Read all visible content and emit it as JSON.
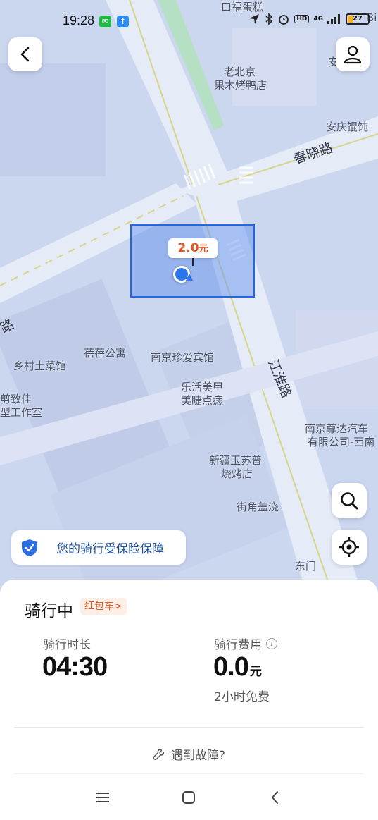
{
  "status_bar": {
    "time": "19:28",
    "network": "4G",
    "hd": "HD",
    "battery": "27",
    "battery_level": 0.27
  },
  "map": {
    "places": [
      {
        "id": "kou-fu",
        "text": "口福蛋糕"
      },
      {
        "id": "lao-beijing-1",
        "text": "老北京"
      },
      {
        "id": "lao-beijing-2",
        "text": "果木烤鸭店"
      },
      {
        "id": "an-qing",
        "text": "安庆馄饨"
      },
      {
        "id": "an-top",
        "text": "安"
      },
      {
        "id": "bi-top",
        "text": "Bi"
      },
      {
        "id": "beibei",
        "text": "蓓蓓公寓"
      },
      {
        "id": "xiangcun",
        "text": "乡村土菜馆"
      },
      {
        "id": "zhenai",
        "text": "南京珍爱宾馆"
      },
      {
        "id": "jian-1",
        "text": "剪致佳"
      },
      {
        "id": "jian-2",
        "text": "型工作室"
      },
      {
        "id": "lehuo-1",
        "text": "乐活美甲"
      },
      {
        "id": "lehuo-2",
        "text": "美睫点痣"
      },
      {
        "id": "zunda-1",
        "text": "南京尊达汽车"
      },
      {
        "id": "zunda-2",
        "text": "有限公司-西南"
      },
      {
        "id": "xinjiang-1",
        "text": "新疆玉苏普"
      },
      {
        "id": "xinjiang-2",
        "text": "烧烤店"
      },
      {
        "id": "jiejiao",
        "text": "街角盖浇"
      },
      {
        "id": "dongmen",
        "text": "东门"
      }
    ],
    "roads": {
      "chunxiao": "春晓路",
      "jianghuai": "江淮路",
      "lu_left": "路"
    }
  },
  "fare_pin": {
    "value": "2.0",
    "unit": "元"
  },
  "insurance": {
    "text": "您的骑行受保险保障"
  },
  "sheet": {
    "status": "骑行中",
    "tag": "红包车>",
    "duration_label": "骑行时长",
    "duration_value": "04:30",
    "cost_label": "骑行费用",
    "cost_value": "0.0",
    "cost_unit": "元",
    "free_note": "2小时免费",
    "fault_link": "遇到故障?"
  },
  "colors": {
    "primary": "#2a75ec",
    "fare": "#e2531d",
    "map_bg": "#cbd6ef",
    "insurance_text": "#1d4f9c"
  }
}
